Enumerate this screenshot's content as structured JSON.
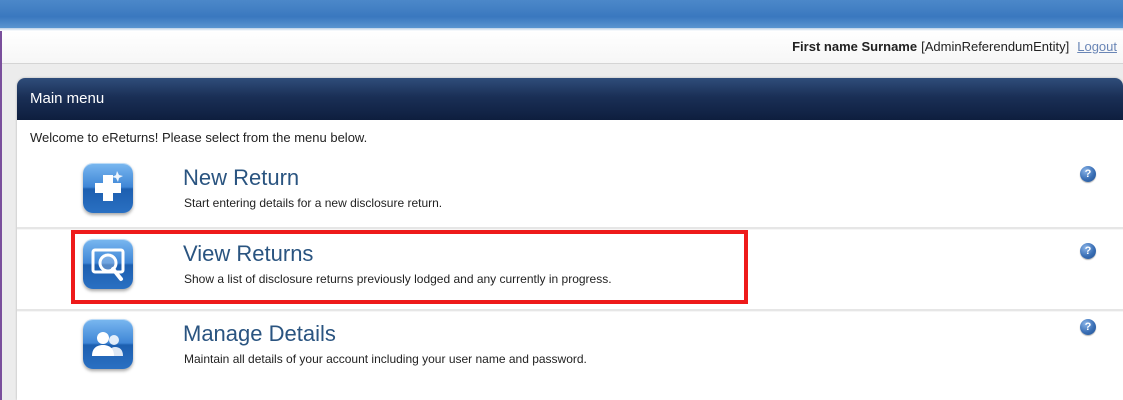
{
  "header": {
    "user_name": "First name Surname",
    "user_role": "[AdminReferendumEntity]",
    "logout_label": "Logout"
  },
  "menu": {
    "title": "Main menu",
    "welcome": "Welcome to eReturns! Please select from the menu below.",
    "items": [
      {
        "icon": "plus-icon",
        "title": "New Return",
        "description": "Start entering details for a new disclosure return."
      },
      {
        "icon": "magnifier-icon",
        "title": "View Returns",
        "description": "Show a list of disclosure returns previously lodged and any currently in progress."
      },
      {
        "icon": "users-icon",
        "title": "Manage Details",
        "description": "Maintain all details of your account including your user name and password."
      }
    ],
    "help_glyph": "?"
  },
  "colors": {
    "accent": "#2a5480",
    "header_dark": "#0e1e3e",
    "highlight": "#ee1a1a",
    "link": "#6a86b6"
  }
}
